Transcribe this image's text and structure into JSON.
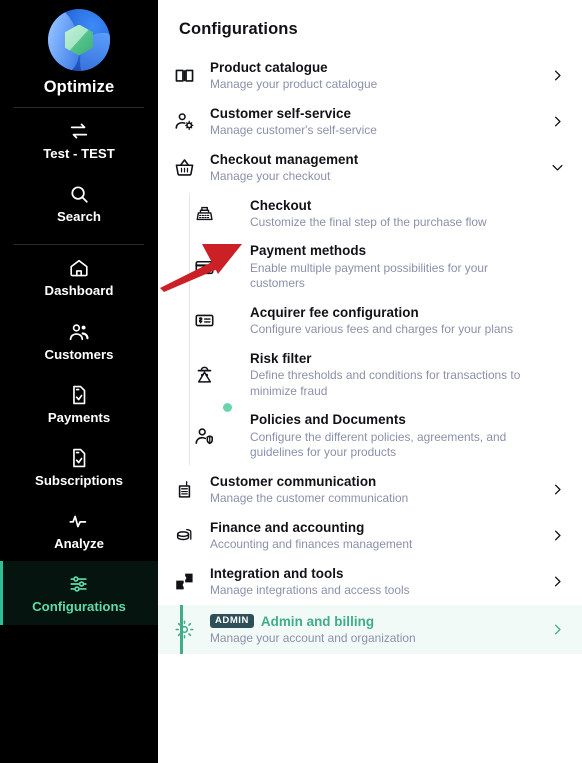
{
  "sidebar": {
    "brand": {
      "name": "Optimize",
      "logo_icon": "optimize-logo-icon"
    },
    "items": [
      {
        "label": "Test - TEST",
        "icon": "switch-arrows-icon",
        "active": false
      },
      {
        "label": "Search",
        "icon": "search-icon",
        "active": false
      },
      {
        "label": "Dashboard",
        "icon": "home-icon",
        "active": false
      },
      {
        "label": "Customers",
        "icon": "users-icon",
        "active": false
      },
      {
        "label": "Payments",
        "icon": "document-icon",
        "active": false
      },
      {
        "label": "Subscriptions",
        "icon": "document-icon",
        "active": false
      },
      {
        "label": "Analyze",
        "icon": "pulse-icon",
        "active": false
      },
      {
        "label": "Configurations",
        "icon": "sliders-icon",
        "active": true
      }
    ]
  },
  "header": {
    "title": "Configurations"
  },
  "colors": {
    "accent_green": "#3fae87",
    "sidebar_active_text": "#5ddcaa",
    "badge_bg": "#2f4f58",
    "subtitle": "#8b90aa",
    "annotation_red": "#cc2027",
    "dot_badge": "#6bd4ab",
    "highlight_bg": "#f1faf6"
  },
  "main": {
    "rows": [
      {
        "title": "Product catalogue",
        "subtitle": "Manage your product catalogue",
        "icon": "book-icon",
        "chevron": "chevron-right-icon"
      },
      {
        "title": "Customer self-service",
        "subtitle": "Manage customer's self-service",
        "icon": "user-gear-icon",
        "chevron": "chevron-right-icon"
      },
      {
        "title": "Checkout management",
        "subtitle": "Manage your checkout",
        "icon": "basket-icon",
        "chevron": "chevron-down-icon",
        "expanded": true,
        "children": [
          {
            "title": "Checkout",
            "subtitle": "Customize the final step of the purchase flow",
            "icon": "cash-register-icon",
            "annotated": true
          },
          {
            "title": "Payment methods",
            "subtitle": "Enable multiple payment possibilities for your customers",
            "icon": "credit-card-icon"
          },
          {
            "title": "Acquirer fee configuration",
            "subtitle": "Configure various fees and charges for your plans",
            "icon": "fee-receipt-icon"
          },
          {
            "title": "Risk filter",
            "subtitle": "Define thresholds and conditions for transactions to minimize fraud",
            "icon": "spy-icon"
          },
          {
            "title": "Policies and Documents",
            "subtitle": "Configure the different policies, agreements, and guidelines for your products",
            "icon": "user-shield-icon",
            "dot_badge": true
          }
        ]
      },
      {
        "title": "Customer communication",
        "subtitle": "Manage the customer communication",
        "icon": "radio-icon",
        "chevron": "chevron-right-icon"
      },
      {
        "title": "Finance and accounting",
        "subtitle": "Accounting and finances management",
        "icon": "coins-icon",
        "chevron": "chevron-right-icon"
      },
      {
        "title": "Integration and tools",
        "subtitle": "Manage integrations and access tools",
        "icon": "puzzle-icon",
        "chevron": "chevron-right-icon"
      },
      {
        "title": "Admin and billing",
        "subtitle": "Manage your account and organization",
        "icon": "gear-icon",
        "chevron": "chevron-right-icon",
        "badge": "ADMIN",
        "highlighted": true
      }
    ]
  },
  "annotation": {
    "type": "arrow",
    "points_to": "Checkout"
  }
}
